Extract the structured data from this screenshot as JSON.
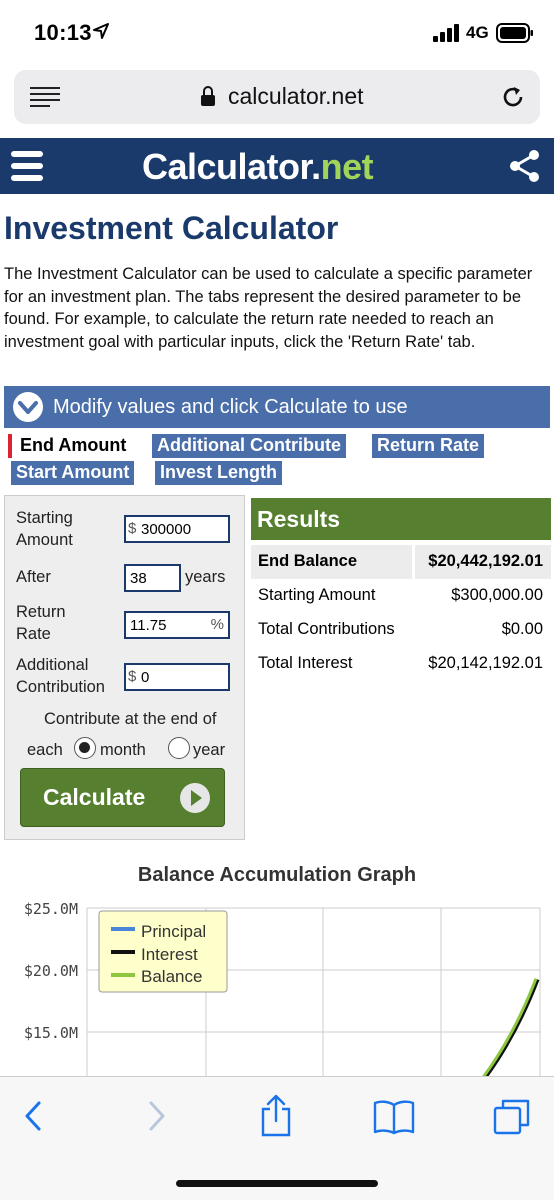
{
  "status": {
    "time": "10:13",
    "network": "4G"
  },
  "browser": {
    "url": "calculator.net"
  },
  "site": {
    "logo_main": "Calculator",
    "logo_dot": ".",
    "logo_net": "net"
  },
  "page": {
    "title": "Investment Calculator",
    "intro": "The Investment Calculator can be used to calculate a specific parameter for an investment plan. The tabs represent the desired parameter to be found. For example, to calculate the return rate needed to reach an investment goal with particular inputs, click the 'Return Rate' tab.",
    "modify_label": "Modify values and click Calculate to use"
  },
  "tabs": [
    {
      "label": "End Amount",
      "active": true
    },
    {
      "label": "Additional Contribute",
      "active": false
    },
    {
      "label": "Return Rate",
      "active": false
    },
    {
      "label": "Start Amount",
      "active": false
    },
    {
      "label": "Invest Length",
      "active": false
    }
  ],
  "form": {
    "starting_amount": {
      "label_1": "Starting",
      "label_2": "Amount",
      "prefix": "$",
      "value": "300000"
    },
    "after": {
      "label": "After",
      "value": "38",
      "unit": "years"
    },
    "return_rate": {
      "label_1": "Return",
      "label_2": "Rate",
      "value": "11.75",
      "suffix": "%"
    },
    "additional": {
      "label_1": "Additional",
      "label_2": "Contribution",
      "prefix": "$",
      "value": "0"
    },
    "contribute_line_1": "Contribute at the end of",
    "contribute_prefix": "each",
    "option_month": "month",
    "option_year": "year",
    "selected": "month",
    "calculate_label": "Calculate"
  },
  "results": {
    "header": "Results",
    "rows": [
      {
        "label": "End Balance",
        "value": "$20,442,192.01"
      },
      {
        "label": "Starting Amount",
        "value": "$300,000.00"
      },
      {
        "label": "Total Contributions",
        "value": "$0.00"
      },
      {
        "label": "Total Interest",
        "value": "$20,142,192.01"
      }
    ]
  },
  "chart_data": {
    "type": "line",
    "title": "Balance Accumulation Graph",
    "y_tick_labels": [
      "$25.0M",
      "$20.0M",
      "$15.0M"
    ],
    "visible_ylim": [
      13000000,
      25000000
    ],
    "legend_position": "top-left",
    "grid": true,
    "series": [
      {
        "name": "Principal",
        "color": "#4a86d8"
      },
      {
        "name": "Interest",
        "color": "#111111"
      },
      {
        "name": "Balance",
        "color": "#8dc63f",
        "visible_points": [
          [
            36,
            13000000
          ],
          [
            38,
            20442192
          ]
        ]
      }
    ]
  },
  "colors": {
    "brand_navy": "#1a3a6b",
    "tab_blue": "#4a6ea9",
    "results_green": "#56802f",
    "active_tab_marker": "#dd2233"
  }
}
